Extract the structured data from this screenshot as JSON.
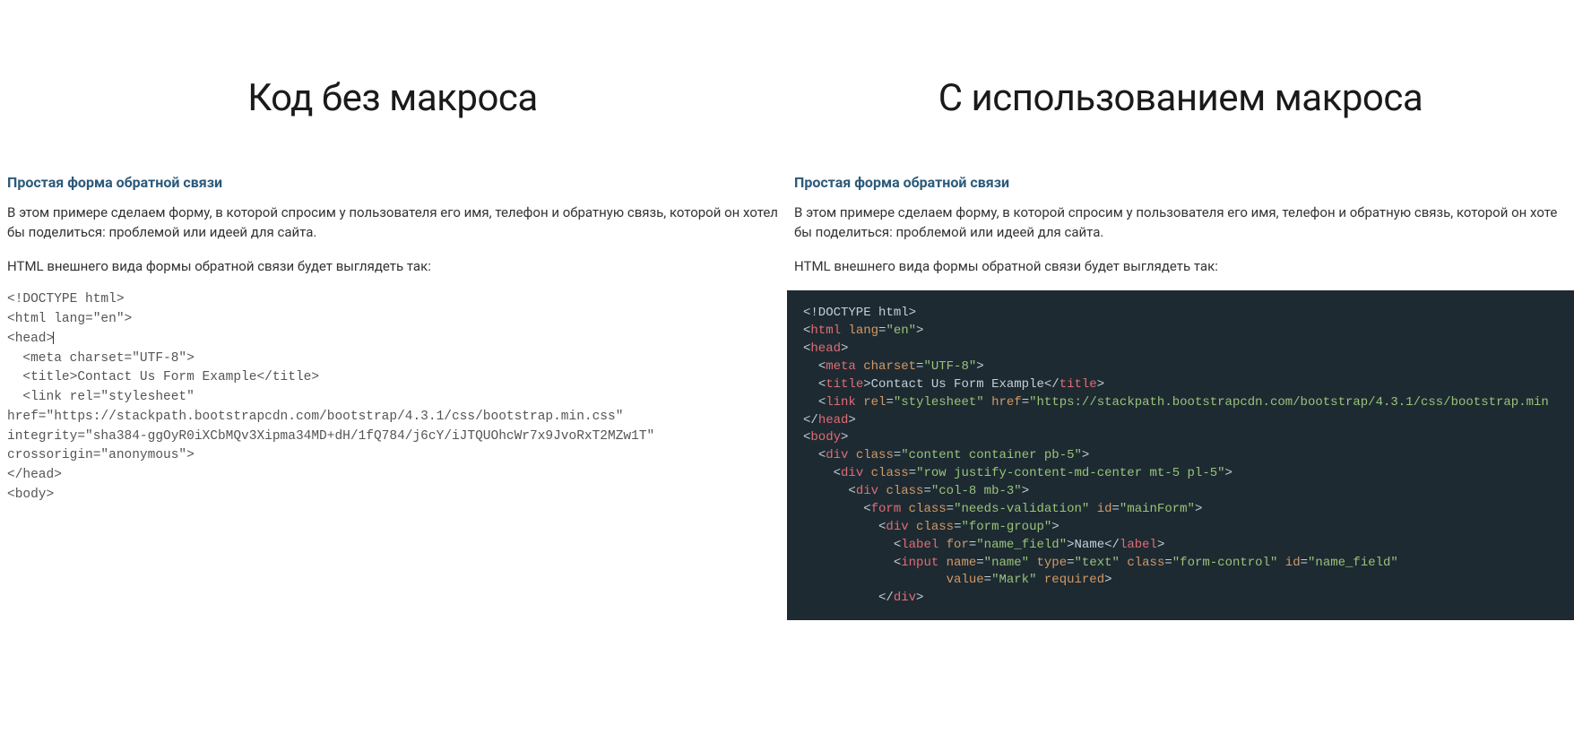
{
  "left": {
    "big_title": "Код без макроса",
    "section_title": "Простая форма обратной связи",
    "p1": "В этом примере сделаем форму, в которой спросим у пользователя его имя, телефон и обратную связь, которой он хотел бы поделиться: проблемой или идеей для сайта.",
    "p2": "HTML внешнего вида формы обратной связи будет выглядеть так:",
    "code": {
      "l1": "<!DOCTYPE html>",
      "l2": "<html lang=\"en\">",
      "l3": "<head>",
      "l4": "  <meta charset=\"UTF-8\">",
      "l5": "  <title>Contact Us Form Example</title>",
      "l6a": "  <link rel=\"stylesheet\"",
      "l6b": "href=\"https://stackpath.bootstrapcdn.com/bootstrap/4.3.1/css/bootstrap.min.css\"",
      "l6c": "integrity=\"sha384-ggOyR0iXCbMQv3Xipma34MD+dH/1fQ784/j6cY/iJTQUOhcWr7x9JvoRxT2MZw1T\"",
      "l6d": "crossorigin=\"anonymous\">",
      "l7": "</head>",
      "l8": "<body>"
    }
  },
  "right": {
    "big_title": "С использованием макроса",
    "section_title": "Простая форма обратной связи",
    "p1": "В этом примере сделаем форму, в которой спросим у пользователя его имя, телефон и обратную связь, которой он хоте бы поделиться: проблемой или идеей для сайта.",
    "p2": "HTML внешнего вида формы обратной связи будет выглядеть так:",
    "code": {
      "doctype": "<!DOCTYPE html>",
      "html_tag": "html",
      "lang_attr": "lang",
      "lang_val": "\"en\"",
      "head_tag": "head",
      "meta_tag": "meta",
      "charset_attr": "charset",
      "charset_val": "\"UTF-8\"",
      "title_tag": "title",
      "title_text": "Contact Us Form Example",
      "link_tag": "link",
      "rel_attr": "rel",
      "rel_val": "\"stylesheet\"",
      "href_attr": "href",
      "href_val": "\"https://stackpath.bootstrapcdn.com/bootstrap/4.3.1/css/bootstrap.min",
      "body_tag": "body",
      "div_tag": "div",
      "class_attr": "class",
      "div1_class": "\"content container pb-5\"",
      "div2_class": "\"row justify-content-md-center mt-5 pl-5\"",
      "div3_class": "\"col-8 mb-3\"",
      "form_tag": "form",
      "form_class": "\"needs-validation\"",
      "id_attr": "id",
      "form_id": "\"mainForm\"",
      "div4_class": "\"form-group\"",
      "label_tag": "label",
      "for_attr": "for",
      "label_for": "\"name_field\"",
      "label_text": "Name",
      "input_tag": "input",
      "name_attr": "name",
      "input_name": "\"name\"",
      "type_attr": "type",
      "input_type": "\"text\"",
      "input_class": "\"form-control\"",
      "input_id": "\"name_field\"",
      "value_attr": "value",
      "input_value": "\"Mark\"",
      "required": "required"
    }
  }
}
